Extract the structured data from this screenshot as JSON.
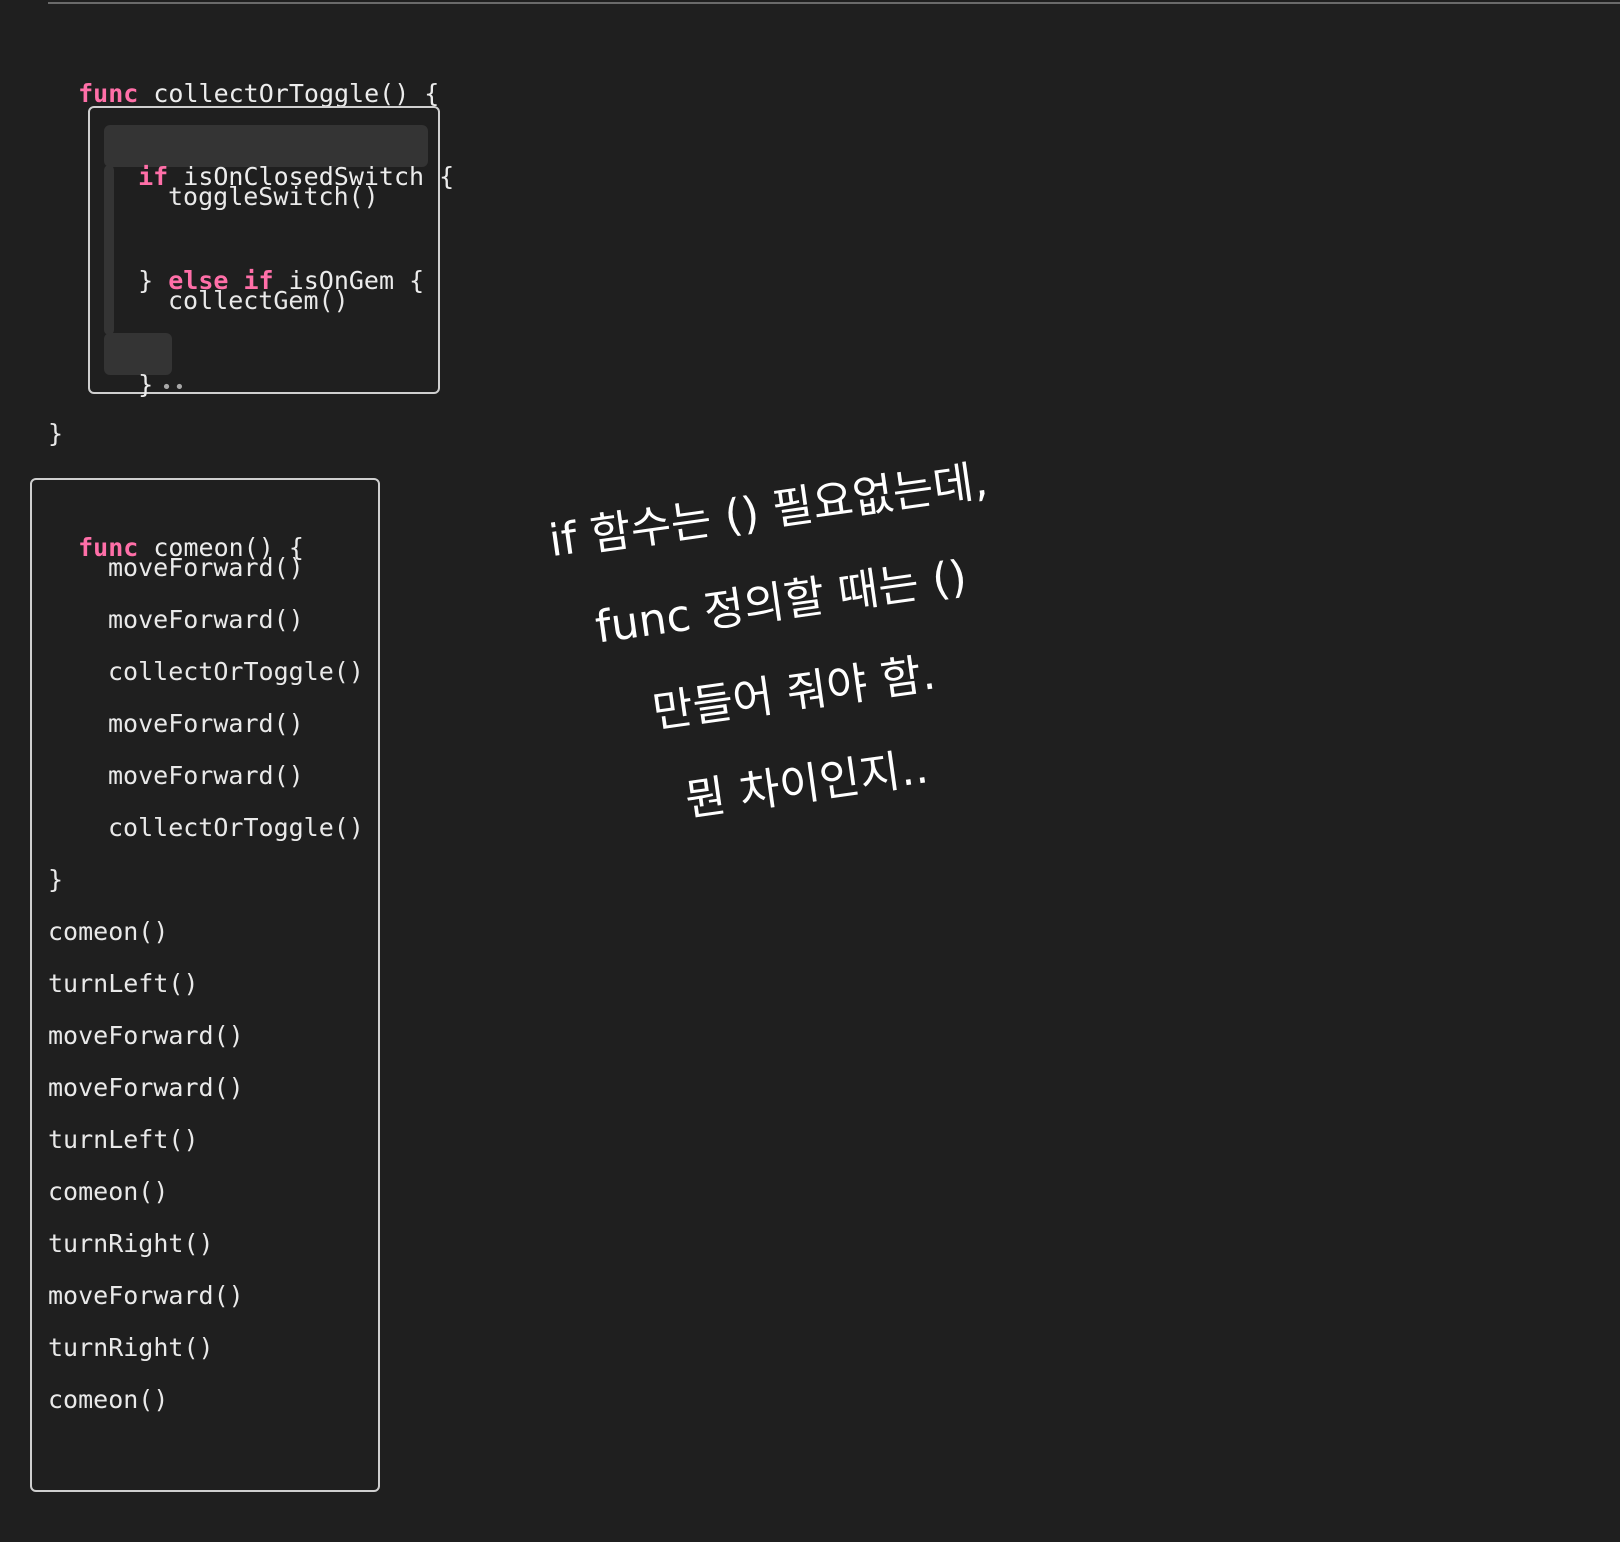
{
  "func1": {
    "kw_func": "func",
    "signature": " collectOrToggle() {",
    "kw_if": "if",
    "if_condition": " isOnClosedSwitch {",
    "toggle_call": "toggleSwitch()",
    "else_brace": "} ",
    "kw_else": "else",
    "kw_if2": "if",
    "elseif_condition": " isOnGem {",
    "collect_call": "collectGem()",
    "inner_close": "}",
    "dots": "••",
    "outer_close": "}"
  },
  "func2": {
    "kw_func": "func",
    "signature": " comeon() {",
    "body": [
      "moveForward()",
      "moveForward()",
      "collectOrToggle()",
      "moveForward()",
      "moveForward()",
      "collectOrToggle()"
    ],
    "close": "}",
    "calls": [
      "comeon()",
      "turnLeft()",
      "moveForward()",
      "moveForward()",
      "turnLeft()",
      "comeon()",
      "turnRight()",
      "moveForward()",
      "turnRight()",
      "comeon()"
    ]
  },
  "note": {
    "lines": [
      "if 함수는 () 필요없는데,",
      "func 정의할 때는 ()",
      "만들어 줘야 함.",
      "뭔 차이인지.."
    ]
  },
  "colors": {
    "background": "#1f1f1f",
    "keyword": "#ff6fa8",
    "text": "#ececec",
    "box_border": "#cfcfcf"
  }
}
